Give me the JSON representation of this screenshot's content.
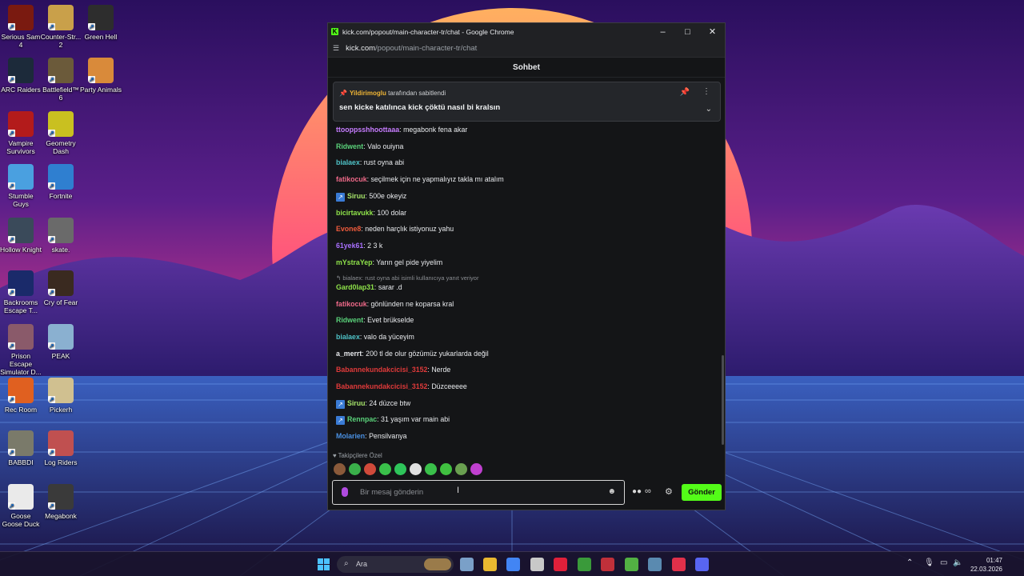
{
  "desktop": {
    "icons": [
      {
        "label": "Serious Sam 4",
        "icon": "serious-sam-icon",
        "color": "#7a1a10"
      },
      {
        "label": "Counter-Str... 2",
        "icon": "counter-strike-icon",
        "color": "#c9a04a"
      },
      {
        "label": "Green Hell",
        "icon": "green-hell-icon",
        "color": "#2d2d2d"
      },
      {
        "label": "ARC Raiders",
        "icon": "arc-raiders-icon",
        "color": "#1c2a3a"
      },
      {
        "label": "Battlefield™ 6",
        "icon": "battlefield-icon",
        "color": "#6b5a3a"
      },
      {
        "label": "Party Animals",
        "icon": "party-animals-icon",
        "color": "#d98a3a"
      },
      {
        "label": "Vampire Survivors",
        "icon": "vampire-survivors-icon",
        "color": "#b31b1b"
      },
      {
        "label": "Geometry Dash",
        "icon": "geometry-dash-icon",
        "color": "#c9c020"
      },
      {
        "label": "Stumble Guys",
        "icon": "stumble-guys-icon",
        "color": "#4aa0e0"
      },
      {
        "label": "Fortnite",
        "icon": "fortnite-icon",
        "color": "#2f7fd0"
      },
      {
        "label": "Hollow Knight",
        "icon": "hollow-knight-icon",
        "color": "#3a4a5a"
      },
      {
        "label": "skate.",
        "icon": "skate-icon",
        "color": "#6a6a6a"
      },
      {
        "label": "Backrooms Escape T...",
        "icon": "backrooms-icon",
        "color": "#1a2a6a"
      },
      {
        "label": "Cry of Fear",
        "icon": "cry-of-fear-icon",
        "color": "#3a2a20"
      },
      {
        "label": "Prison Escape Simulator D...",
        "icon": "prison-escape-icon",
        "color": "#8a5a6a"
      },
      {
        "label": "PEAK",
        "icon": "peak-icon",
        "color": "#8ab0d0"
      },
      {
        "label": "Rec Room",
        "icon": "rec-room-icon",
        "color": "#e06020"
      },
      {
        "label": "Pickerh",
        "icon": "pickerh-icon",
        "color": "#d0c090"
      },
      {
        "label": "BABBDI",
        "icon": "babbdi-icon",
        "color": "#7a7a6a"
      },
      {
        "label": "Log Riders",
        "icon": "log-riders-icon",
        "color": "#c05050"
      },
      {
        "label": "Goose Goose Duck",
        "icon": "goose-goose-duck-icon",
        "color": "#eaeaea"
      },
      {
        "label": "Megabonk",
        "icon": "megabonk-icon",
        "color": "#3a3a3a"
      }
    ]
  },
  "window": {
    "title": "kick.com/popout/main-character-tr/chat - Google Chrome",
    "url_host": "kick.com",
    "url_path": "/popout/main-character-tr/chat"
  },
  "chat": {
    "header": "Sohbet",
    "pinned": {
      "by_user": "Yildirimoglu",
      "by_suffix": "tarafından sabitlendi",
      "message": "sen kicke katılınca kick çöktü nasıl bi kralsın"
    },
    "messages": [
      {
        "user": "ttooppsshhoottaaa",
        "color": "#c77dff",
        "text": "megabonk fena akar",
        "badge": false
      },
      {
        "user": "Ridwent",
        "color": "#5ad27a",
        "text": "Valo ouiyna",
        "badge": false
      },
      {
        "user": "bialaex",
        "color": "#4fc3c8",
        "text": "rust oyna abi",
        "badge": false
      },
      {
        "user": "fatikocuk",
        "color": "#f06a8a",
        "text": "seçilmek için ne yapmalıyız takla mı atalım",
        "badge": false
      },
      {
        "user": "Siruu",
        "color": "#a6e36a",
        "text": "500e okeyiz",
        "badge": true
      },
      {
        "user": "bicirtavukk",
        "color": "#8fe34a",
        "text": "100 dolar",
        "badge": false
      },
      {
        "user": "Evone8",
        "color": "#ef5b3c",
        "text": "neden harçlık istiyonuz yahu",
        "badge": false
      },
      {
        "user": "61yek61",
        "color": "#a970ff",
        "text": "2 3 k",
        "badge": false
      },
      {
        "user": "mYstraYep",
        "color": "#8fe34a",
        "text": "Yarın gel pide yiyelim",
        "badge": false
      },
      {
        "user": "Gard0lap31",
        "color": "#8fe34a",
        "text": "sarar .d",
        "badge": false
      },
      {
        "user": "fatikocuk",
        "color": "#f06a8a",
        "text": "gönlünden ne koparsa kral",
        "badge": false
      },
      {
        "user": "Ridwent",
        "color": "#5ad27a",
        "text": "Evet brükselde",
        "badge": false
      },
      {
        "user": "bialaex",
        "color": "#4fc3c8",
        "text": "valo da yüceyim",
        "badge": false
      },
      {
        "user": "a_merrt",
        "color": "#e8eaed",
        "text": "200 tl de olur gözümüz yukarlarda değil",
        "badge": false
      },
      {
        "user": "Babannekundakcicisi_3152",
        "color": "#e03a3a",
        "text": "Nerde",
        "badge": false
      },
      {
        "user": "Babannekundakcicisi_3152",
        "color": "#e03a3a",
        "text": "Düzceeeee",
        "badge": false
      },
      {
        "user": "Siruu",
        "color": "#a6e36a",
        "text": "24 düzce btw",
        "badge": true
      },
      {
        "user": "Rennpac",
        "color": "#5ad27a",
        "text": "31 yaşım var main abi",
        "badge": true
      },
      {
        "user": "Molarien",
        "color": "#4a90e2",
        "text": "Pensilvanya",
        "badge": false
      }
    ],
    "reply_note": "bialaex: rust oyna abi isimli kullanıcıya yanıt veriyor",
    "followers_only": "Takipçilere Özel",
    "input_placeholder": "Bir mesaj gönderin",
    "send_label": "Gönder",
    "emote_colors": [
      "#8a5a3a",
      "#3ab04a",
      "#d04a3a",
      "#3ac04a",
      "#2ec45a",
      "#e0e0e0",
      "#3ac04a",
      "#40c040",
      "#6aa050",
      "#c040d0"
    ]
  },
  "taskbar": {
    "search_label": "Ara",
    "time": "01:47",
    "date": "22.03.2026",
    "apps": [
      {
        "icon": "settings-icon",
        "color": "#7aa0c8"
      },
      {
        "icon": "file-explorer-icon",
        "color": "#e8b830"
      },
      {
        "icon": "chrome-icon",
        "color": "#4285f4"
      },
      {
        "icon": "obs-icon",
        "color": "#c8c8c8"
      },
      {
        "icon": "opera-icon",
        "color": "#e0203a"
      },
      {
        "icon": "xbox-icon",
        "color": "#3a9a3a"
      },
      {
        "icon": "redapp-icon",
        "color": "#c0303a"
      },
      {
        "icon": "xbox-app-icon",
        "color": "#52b043"
      },
      {
        "icon": "steam-icon",
        "color": "#5a8ab0"
      },
      {
        "icon": "opera-gx-icon",
        "color": "#e0304a"
      },
      {
        "icon": "discord-icon",
        "color": "#5865f2"
      }
    ]
  }
}
